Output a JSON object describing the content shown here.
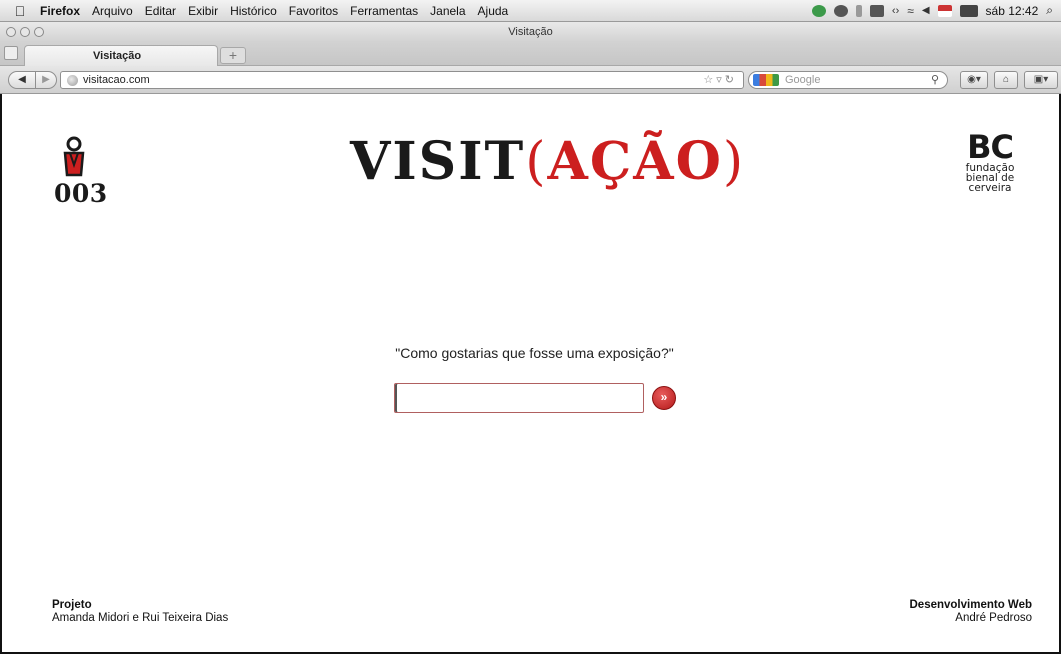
{
  "menubar": {
    "app_name": "Firefox",
    "items": [
      "Arquivo",
      "Editar",
      "Exibir",
      "Histórico",
      "Favoritos",
      "Ferramentas",
      "Janela",
      "Ajuda"
    ],
    "clock": "sáb 12:42"
  },
  "window": {
    "title": "Visitação"
  },
  "tabs": [
    {
      "label": "Visitação",
      "active": true
    }
  ],
  "navbar": {
    "url": "visitacao.com",
    "search_placeholder": "Google"
  },
  "page": {
    "badge_number": "003",
    "title_main": "VISIT",
    "title_paren_open": "(",
    "title_accent": "AÇÃO",
    "title_paren_close": ")",
    "partner_mark": "BC",
    "partner_line1": "fundação",
    "partner_line2": "bienal de",
    "partner_line3": "cerveira",
    "question": "\"Como gostarias que fosse uma exposição?\"",
    "answer_value": "",
    "submit_label": "»",
    "credit_left_heading": "Projeto",
    "credit_left_names": "Amanda Midori e Rui Teixeira Dias",
    "credit_right_heading": "Desenvolvimento Web",
    "credit_right_names": "André Pedroso"
  },
  "colors": {
    "accent_red": "#cc1f1f",
    "text_dark": "#1a1a1a"
  }
}
